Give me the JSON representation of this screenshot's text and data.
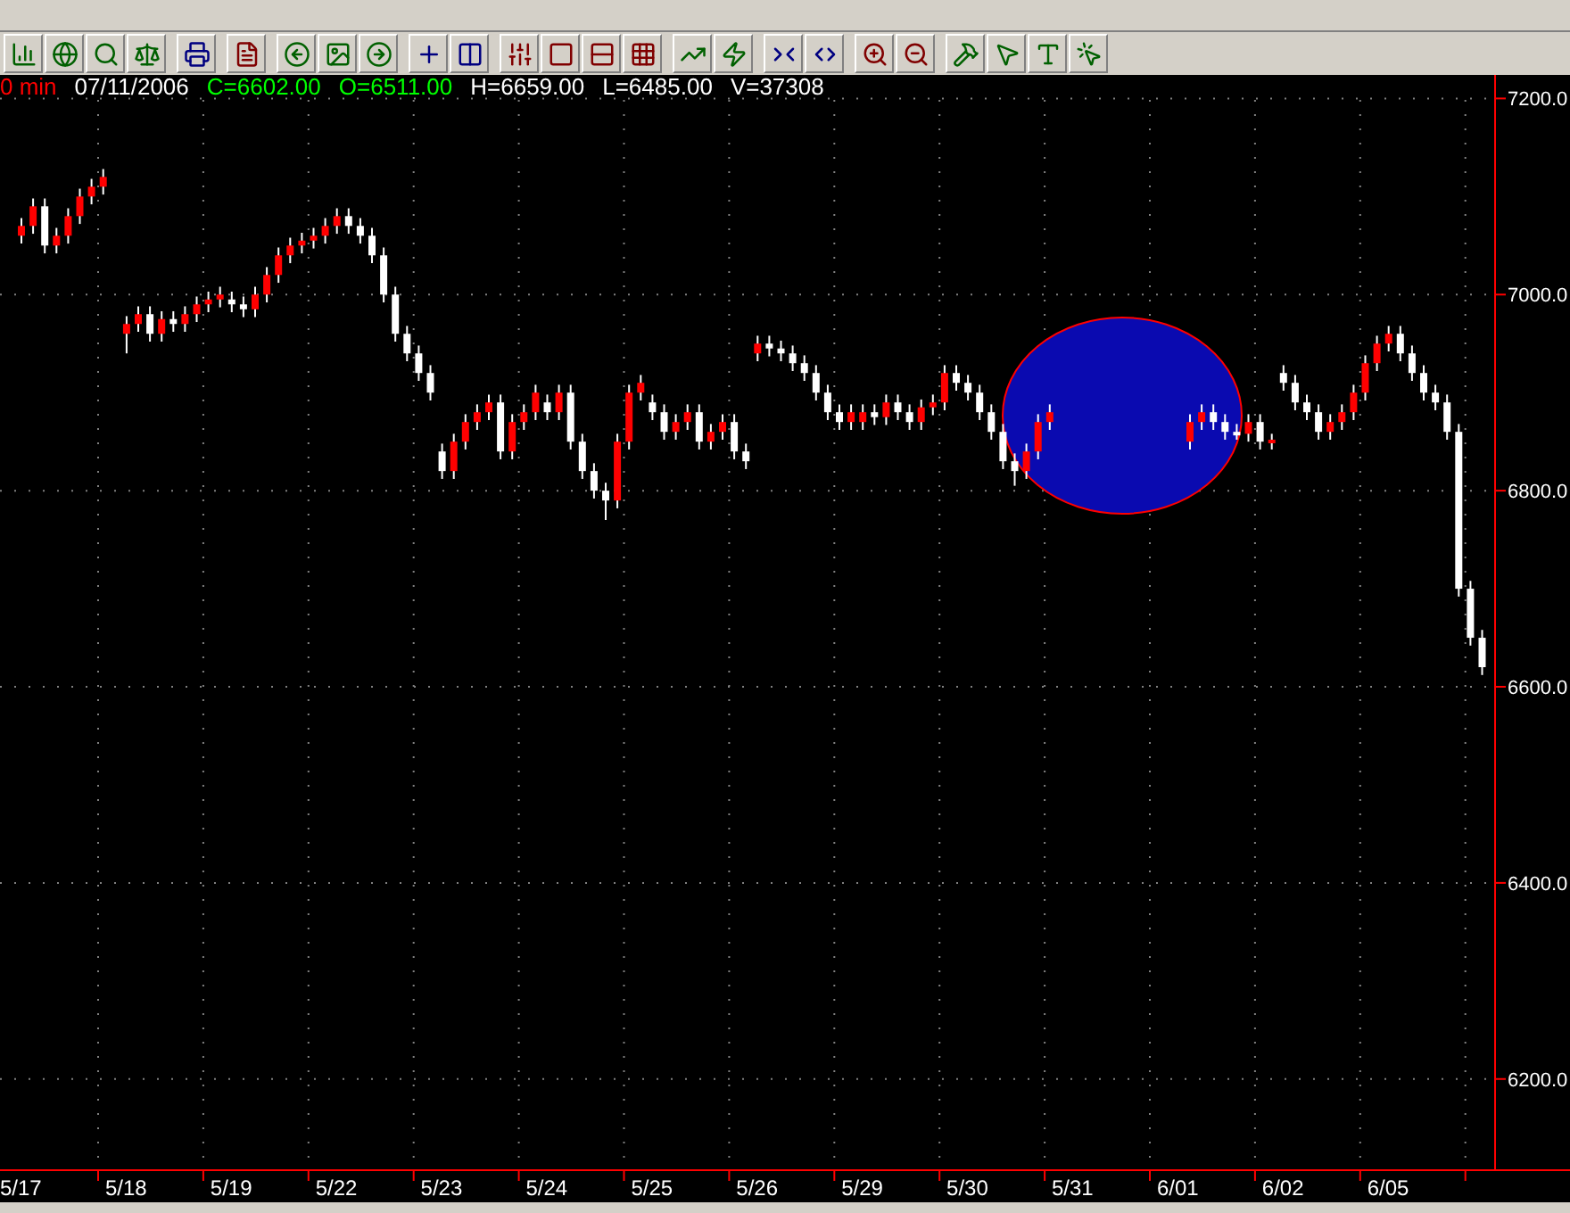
{
  "quote_header": [
    {
      "text": "0 min",
      "color": "#ff0000"
    },
    {
      "text": "07/11/2006",
      "color": "#ffffff"
    },
    {
      "text": "C=6602.00",
      "color": "#00ff00"
    },
    {
      "text": "O=6511.00",
      "color": "#00ff00"
    },
    {
      "text": "H=6659.00",
      "color": "#ffffff"
    },
    {
      "text": "L=6485.00",
      "color": "#ffffff"
    },
    {
      "text": "V=37308",
      "color": "#ffffff"
    }
  ],
  "chart": {
    "chart_data": {
      "type": "candlestick",
      "grid": true,
      "ylim": [
        6107,
        7224
      ],
      "yticks": [
        {
          "value": 7200,
          "label": "7200.0"
        },
        {
          "value": 7000,
          "label": "7000.0"
        },
        {
          "value": 6800,
          "label": "6800.0"
        },
        {
          "value": 6600,
          "label": "6600.0"
        },
        {
          "value": 6400,
          "label": "6400.0"
        },
        {
          "value": 6200,
          "label": "6200.0"
        }
      ],
      "categories": [
        "5/17",
        null,
        null,
        null,
        null,
        null,
        null,
        null,
        null,
        "5/18",
        null,
        null,
        null,
        null,
        null,
        null,
        null,
        null,
        "5/19",
        null,
        null,
        null,
        null,
        null,
        null,
        null,
        null,
        "5/22",
        null,
        null,
        null,
        null,
        null,
        null,
        null,
        null,
        "5/23",
        null,
        null,
        null,
        null,
        null,
        null,
        null,
        null,
        "5/24",
        null,
        null,
        null,
        null,
        null,
        null,
        null,
        null,
        "5/25",
        null,
        null,
        null,
        null,
        null,
        null,
        null,
        null,
        "5/26",
        null,
        null,
        null,
        null,
        null,
        null,
        null,
        null,
        "5/29",
        null,
        null,
        null,
        null,
        null,
        null,
        null,
        null,
        "5/30",
        null,
        null,
        null,
        null,
        null,
        null,
        null,
        null,
        "5/31",
        null,
        null,
        null,
        null,
        null,
        null,
        null,
        null,
        "6/01",
        null,
        null,
        null,
        null,
        null,
        null,
        null,
        null,
        "6/02",
        null,
        null,
        null,
        null,
        null,
        null,
        null,
        null,
        "6/05",
        null,
        null,
        null,
        null,
        null,
        null,
        null,
        null
      ],
      "ohlc": [
        [
          7060,
          7078,
          7052,
          7070
        ],
        [
          7070,
          7098,
          7062,
          7090
        ],
        [
          7090,
          7098,
          7042,
          7050
        ],
        [
          7050,
          7068,
          7042,
          7060
        ],
        [
          7060,
          7088,
          7052,
          7080
        ],
        [
          7080,
          7108,
          7072,
          7100
        ],
        [
          7100,
          7118,
          7092,
          7110
        ],
        [
          7110,
          7128,
          7102,
          7120
        ],
        null,
        [
          6960,
          6978,
          6940,
          6970
        ],
        [
          6970,
          6988,
          6962,
          6980
        ],
        [
          6980,
          6988,
          6952,
          6960
        ],
        [
          6960,
          6983,
          6952,
          6975
        ],
        [
          6975,
          6983,
          6962,
          6970
        ],
        [
          6970,
          6988,
          6962,
          6980
        ],
        [
          6980,
          6998,
          6972,
          6990
        ],
        [
          6990,
          7003,
          6982,
          6995
        ],
        [
          6995,
          7008,
          6987,
          7000
        ],
        [
          6995,
          7003,
          6982,
          6990
        ],
        [
          6990,
          6998,
          6977,
          6985
        ],
        [
          6985,
          7008,
          6977,
          7000
        ],
        [
          7000,
          7028,
          6992,
          7020
        ],
        [
          7020,
          7048,
          7012,
          7040
        ],
        [
          7040,
          7058,
          7032,
          7050
        ],
        [
          7050,
          7063,
          7042,
          7055
        ],
        [
          7055,
          7068,
          7047,
          7060
        ],
        [
          7060,
          7078,
          7052,
          7070
        ],
        [
          7070,
          7088,
          7062,
          7080
        ],
        [
          7080,
          7088,
          7062,
          7070
        ],
        [
          7070,
          7078,
          7052,
          7060
        ],
        [
          7060,
          7068,
          7032,
          7040
        ],
        [
          7040,
          7048,
          6992,
          7000
        ],
        [
          7000,
          7008,
          6952,
          6960
        ],
        [
          6960,
          6968,
          6932,
          6940
        ],
        [
          6940,
          6948,
          6912,
          6920
        ],
        [
          6920,
          6928,
          6892,
          6900
        ],
        [
          6840,
          6848,
          6812,
          6820
        ],
        [
          6820,
          6858,
          6812,
          6850
        ],
        [
          6850,
          6878,
          6842,
          6870
        ],
        [
          6870,
          6888,
          6862,
          6880
        ],
        [
          6880,
          6898,
          6872,
          6890
        ],
        [
          6890,
          6898,
          6832,
          6840
        ],
        [
          6840,
          6878,
          6832,
          6870
        ],
        [
          6870,
          6888,
          6862,
          6880
        ],
        [
          6880,
          6908,
          6872,
          6900
        ],
        [
          6890,
          6898,
          6872,
          6880
        ],
        [
          6880,
          6908,
          6872,
          6900
        ],
        [
          6900,
          6908,
          6842,
          6850
        ],
        [
          6850,
          6858,
          6812,
          6820
        ],
        [
          6820,
          6828,
          6792,
          6800
        ],
        [
          6800,
          6808,
          6770,
          6790
        ],
        [
          6790,
          6858,
          6782,
          6850
        ],
        [
          6850,
          6908,
          6842,
          6900
        ],
        [
          6900,
          6918,
          6892,
          6910
        ],
        [
          6890,
          6898,
          6872,
          6880
        ],
        [
          6880,
          6888,
          6852,
          6860
        ],
        [
          6860,
          6878,
          6852,
          6870
        ],
        [
          6870,
          6888,
          6862,
          6880
        ],
        [
          6880,
          6888,
          6842,
          6850
        ],
        [
          6850,
          6868,
          6842,
          6860
        ],
        [
          6860,
          6878,
          6852,
          6870
        ],
        [
          6870,
          6878,
          6832,
          6840
        ],
        [
          6840,
          6848,
          6822,
          6830
        ],
        [
          6940,
          6958,
          6932,
          6950
        ],
        [
          6950,
          6958,
          6937,
          6945
        ],
        [
          6945,
          6953,
          6932,
          6940
        ],
        [
          6940,
          6948,
          6922,
          6930
        ],
        [
          6930,
          6938,
          6912,
          6920
        ],
        [
          6920,
          6928,
          6892,
          6900
        ],
        [
          6900,
          6908,
          6872,
          6880
        ],
        [
          6880,
          6888,
          6862,
          6870
        ],
        [
          6870,
          6888,
          6862,
          6880
        ],
        [
          6870,
          6888,
          6862,
          6880
        ],
        [
          6880,
          6888,
          6867,
          6875
        ],
        [
          6875,
          6898,
          6867,
          6890
        ],
        [
          6890,
          6898,
          6872,
          6880
        ],
        [
          6880,
          6888,
          6862,
          6870
        ],
        [
          6870,
          6893,
          6862,
          6885
        ],
        [
          6885,
          6898,
          6877,
          6890
        ],
        [
          6890,
          6928,
          6882,
          6920
        ],
        [
          6920,
          6928,
          6902,
          6910
        ],
        [
          6910,
          6918,
          6892,
          6900
        ],
        [
          6900,
          6908,
          6872,
          6880
        ],
        [
          6880,
          6888,
          6852,
          6860
        ],
        [
          6860,
          6868,
          6822,
          6830
        ],
        [
          6830,
          6838,
          6805,
          6820
        ],
        [
          6820,
          6848,
          6812,
          6840
        ],
        [
          6840,
          6878,
          6832,
          6870
        ],
        [
          6870,
          6888,
          6862,
          6880
        ],
        null,
        null,
        null,
        null,
        null,
        null,
        null,
        null,
        null,
        null,
        null,
        [
          6850,
          6878,
          6842,
          6870
        ],
        [
          6870,
          6888,
          6862,
          6880
        ],
        [
          6880,
          6888,
          6862,
          6870
        ],
        [
          6870,
          6878,
          6852,
          6860
        ],
        [
          6860,
          6868,
          6852,
          6858
        ],
        [
          6858,
          6878,
          6850,
          6870
        ],
        [
          6870,
          6878,
          6842,
          6850
        ],
        [
          6850,
          6858,
          6842,
          6852
        ],
        [
          6920,
          6928,
          6902,
          6910
        ],
        [
          6910,
          6918,
          6882,
          6890
        ],
        [
          6890,
          6898,
          6872,
          6880
        ],
        [
          6880,
          6888,
          6852,
          6860
        ],
        [
          6860,
          6878,
          6852,
          6870
        ],
        [
          6870,
          6888,
          6862,
          6880
        ],
        [
          6880,
          6908,
          6872,
          6900
        ],
        [
          6900,
          6938,
          6892,
          6930
        ],
        [
          6930,
          6958,
          6922,
          6950
        ],
        [
          6950,
          6968,
          6942,
          6960
        ],
        [
          6960,
          6968,
          6932,
          6940
        ],
        [
          6940,
          6948,
          6912,
          6920
        ],
        [
          6920,
          6928,
          6892,
          6900
        ],
        [
          6900,
          6908,
          6882,
          6890
        ],
        [
          6890,
          6898,
          6852,
          6860
        ],
        [
          6860,
          6868,
          6692,
          6700
        ],
        [
          6700,
          6708,
          6642,
          6650
        ],
        [
          6650,
          6658,
          6612,
          6620
        ]
      ]
    }
  }
}
